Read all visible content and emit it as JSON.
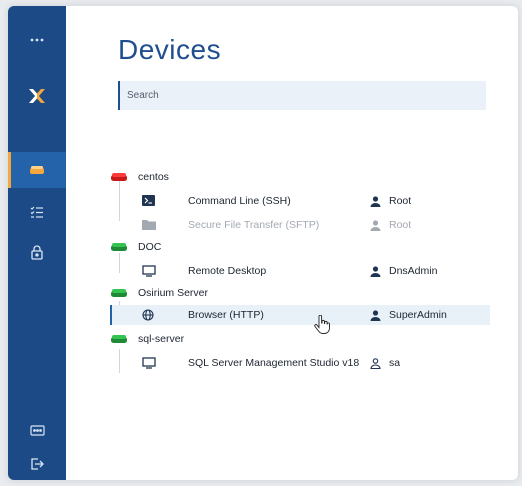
{
  "page": {
    "title": "Devices"
  },
  "search": {
    "placeholder": "Search"
  },
  "sidebar": {
    "items": [
      {
        "name": "more-menu",
        "icon": "more-dots-icon"
      },
      {
        "name": "app-logo",
        "icon": "x-logo-icon"
      },
      {
        "name": "devices",
        "icon": "device-icon",
        "active": true
      },
      {
        "name": "tasks",
        "icon": "checklist-icon"
      },
      {
        "name": "vault",
        "icon": "lock-icon"
      },
      {
        "name": "password",
        "icon": "password-field-icon"
      },
      {
        "name": "logout",
        "icon": "logout-icon"
      }
    ]
  },
  "devices": [
    {
      "name": "centos",
      "status_color": "#e02020",
      "connections": [
        {
          "label": "Command Line (SSH)",
          "icon": "terminal-icon",
          "user": "Root",
          "disabled": false
        },
        {
          "label": "Secure File Transfer (SFTP)",
          "icon": "folder-icon",
          "user": "Root",
          "disabled": true
        }
      ]
    },
    {
      "name": "DOC",
      "status_color": "#28a745",
      "connections": [
        {
          "label": "Remote Desktop",
          "icon": "monitor-icon",
          "user": "DnsAdmin",
          "disabled": false
        }
      ]
    },
    {
      "name": "Osirium Server",
      "status_color": "#28a745",
      "connections": [
        {
          "label": "Browser (HTTP)",
          "icon": "globe-icon",
          "user": "SuperAdmin",
          "disabled": false,
          "selected": true
        }
      ]
    },
    {
      "name": "sql-server",
      "status_color": "#28a745",
      "connections": [
        {
          "label": "SQL Server Management Studio v18",
          "icon": "monitor-icon",
          "user": "sa",
          "disabled": false
        }
      ]
    }
  ],
  "colors": {
    "sidebar": "#1b4a86",
    "sidebar_active": "#2463aa",
    "accent_orange": "#f4a73a",
    "title": "#1f4f8f"
  }
}
